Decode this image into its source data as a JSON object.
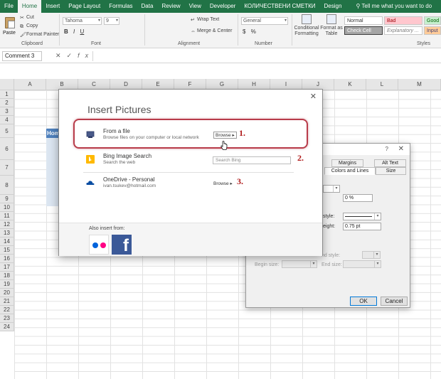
{
  "ribbon_tabs": [
    "File",
    "Home",
    "Insert",
    "Page Layout",
    "Formulas",
    "Data",
    "Review",
    "View",
    "Developer",
    "КОЛИЧЕСТВЕНИ СМЕТКИ",
    "Design"
  ],
  "tell_me": "Tell me what you want to do",
  "ribbon": {
    "clipboard": {
      "paste": "Paste",
      "cut": "Cut",
      "copy": "Copy",
      "format_painter": "Format Painter",
      "label": "Clipboard"
    },
    "font": {
      "name": "Tahoma",
      "size": "9",
      "label": "Font",
      "bold": "B",
      "italic": "I",
      "underline": "U"
    },
    "alignment": {
      "wrap_text": "Wrap Text",
      "merge_center": "Merge & Center",
      "label": "Alignment"
    },
    "number": {
      "format": "General",
      "label": "Number",
      "currency": "$",
      "percent": "%"
    },
    "styles": {
      "conditional_formatting": "Conditional Formatting",
      "format_as_table": "Format as Table",
      "normal": "Normal",
      "bad": "Bad",
      "good": "Good",
      "check_cell": "Check Cell",
      "explanatory": "Explanatory ...",
      "input": "Input",
      "label": "Styles"
    }
  },
  "formula_bar": {
    "name_box": "Comment 3",
    "cancel": "✕",
    "enter": "✓",
    "fx": "fx",
    "content": ""
  },
  "grid": {
    "columns": [
      "A",
      "B",
      "C",
      "D",
      "E",
      "F",
      "G",
      "H",
      "I",
      "J",
      "K",
      "L",
      "M"
    ],
    "rows": [
      "1",
      "2",
      "3",
      "4",
      "5",
      "6",
      "7",
      "8",
      "9",
      "10",
      "11",
      "12",
      "13",
      "14",
      "15",
      "16",
      "17",
      "18",
      "19",
      "20",
      "21",
      "22",
      "23",
      "24"
    ],
    "cell_b5": "Hom"
  },
  "format_dialog": {
    "help": "?",
    "close": "✕",
    "tabs": [
      "Margins",
      "Alt Text",
      "Colors and Lines",
      "Size"
    ],
    "transparency_value": "0 %",
    "style_label": "style:",
    "weight_label": "eight:",
    "weight_value": "0.75 pt",
    "end_style_label": "nd style:",
    "begin_size_label": "Begin size:",
    "end_size_label": "End size:",
    "ok": "OK",
    "cancel": "Cancel"
  },
  "insert_pictures": {
    "title": "Insert Pictures",
    "close": "✕",
    "items": [
      {
        "name": "From a file",
        "description": "Browse files on your computer or local network",
        "action": "Browse ▸"
      },
      {
        "name": "Bing Image Search",
        "description": "Search the web",
        "search_placeholder": "Search Bing"
      },
      {
        "name": "OneDrive - Personal",
        "description": "ivan.tsukev@hotmail.com",
        "action": "Browse ▸"
      }
    ],
    "also_insert_from": "Also insert from:",
    "facebook_glyph": "f"
  },
  "annotations": [
    "1.",
    "2.",
    "3."
  ],
  "colors": {
    "excel_green": "#217346",
    "highlight": "#b83c4a",
    "annotation": "#b01a1a",
    "table_header": "#4f81bd",
    "facebook": "#3b5998"
  }
}
